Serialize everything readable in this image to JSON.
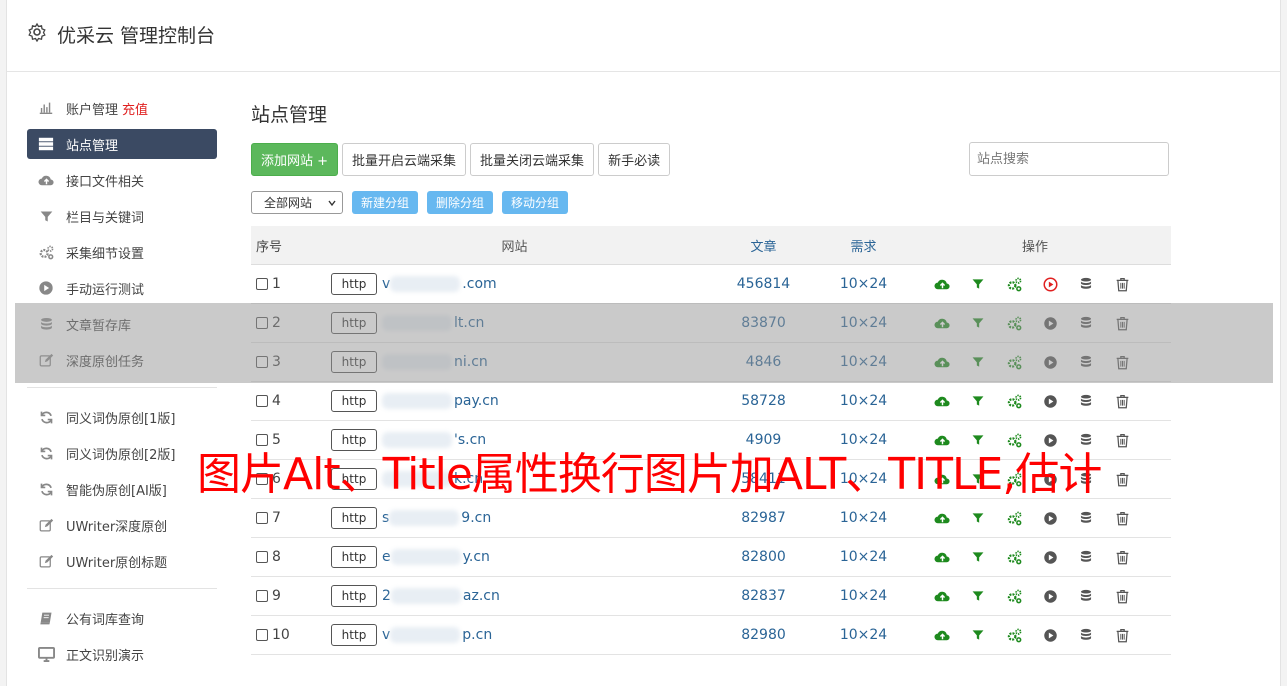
{
  "app": {
    "title": "优采云 管理控制台"
  },
  "sidebar": {
    "group1": [
      {
        "label": "账户管理",
        "extra": "充值",
        "icon": "bar-chart-icon"
      },
      {
        "label": "站点管理",
        "icon": "server-list-icon",
        "active": true
      },
      {
        "label": "接口文件相关",
        "icon": "cloud-upload-icon"
      },
      {
        "label": "栏目与关键词",
        "icon": "filter-icon"
      },
      {
        "label": "采集细节设置",
        "icon": "cogs-icon"
      },
      {
        "label": "手动运行测试",
        "icon": "play-circle-icon"
      },
      {
        "label": "文章暂存库",
        "icon": "database-icon"
      },
      {
        "label": "深度原创任务",
        "icon": "edit-icon"
      }
    ],
    "group2": [
      {
        "label": "同义词伪原创[1版]",
        "icon": "refresh-icon"
      },
      {
        "label": "同义词伪原创[2版]",
        "icon": "refresh-icon"
      },
      {
        "label": "智能伪原创[AI版]",
        "icon": "refresh-icon"
      },
      {
        "label": "UWriter深度原创",
        "icon": "edit-icon"
      },
      {
        "label": "UWriter原创标题",
        "icon": "edit-icon"
      }
    ],
    "group3": [
      {
        "label": "公有词库查询",
        "icon": "book-icon"
      },
      {
        "label": "正文识别演示",
        "icon": "monitor-icon"
      }
    ]
  },
  "main": {
    "title": "站点管理",
    "buttons": {
      "add_site": "添加网站 +",
      "batch_open": "批量开启云端采集",
      "batch_close": "批量关闭云端采集",
      "newbie": "新手必读"
    },
    "search_placeholder": "站点搜索",
    "group_select": "全部网站",
    "group_buttons": {
      "new": "新建分组",
      "delete": "删除分组",
      "move": "移动分组"
    },
    "table": {
      "headers": {
        "no": "序号",
        "site": "网站",
        "articles": "文章",
        "demand": "需求",
        "ops": "操作"
      },
      "rows": [
        {
          "no": "1",
          "proto": "http",
          "pre": "v",
          "post": ".com",
          "articles": "456814",
          "demand": "10×24",
          "run_active": true
        },
        {
          "no": "2",
          "proto": "http",
          "pre": "",
          "post": "lt.cn",
          "articles": "83870",
          "demand": "10×24",
          "run_active": false
        },
        {
          "no": "3",
          "proto": "http",
          "pre": "",
          "post": "ni.cn",
          "articles": "4846",
          "demand": "10×24",
          "run_active": false
        },
        {
          "no": "4",
          "proto": "http",
          "pre": "",
          "post": "pay.cn",
          "articles": "58728",
          "demand": "10×24",
          "run_active": false
        },
        {
          "no": "5",
          "proto": "http",
          "pre": "",
          "post": "'s.cn",
          "articles": "4909",
          "demand": "10×24",
          "run_active": false
        },
        {
          "no": "6",
          "proto": "http",
          "pre": "",
          "post": "k.cn",
          "articles": "58411",
          "demand": "10×24",
          "run_active": false
        },
        {
          "no": "7",
          "proto": "http",
          "pre": "s",
          "post": "9.cn",
          "articles": "82987",
          "demand": "10×24",
          "run_active": false
        },
        {
          "no": "8",
          "proto": "http",
          "pre": "e",
          "post": "y.cn",
          "articles": "82800",
          "demand": "10×24",
          "run_active": false
        },
        {
          "no": "9",
          "proto": "http",
          "pre": "2",
          "post": "az.cn",
          "articles": "82837",
          "demand": "10×24",
          "run_active": false
        },
        {
          "no": "10",
          "proto": "http",
          "pre": "v",
          "post": "p.cn",
          "articles": "82980",
          "demand": "10×24",
          "run_active": false
        }
      ]
    }
  },
  "caption": "图片Alt、Title属性换行图片加ALT、TITLE,估计",
  "colors": {
    "active_nav": "#3b4a63",
    "green": "#5cb85c",
    "link": "#2a6496",
    "run_red": "#e02020",
    "caption": "#ff0000"
  }
}
